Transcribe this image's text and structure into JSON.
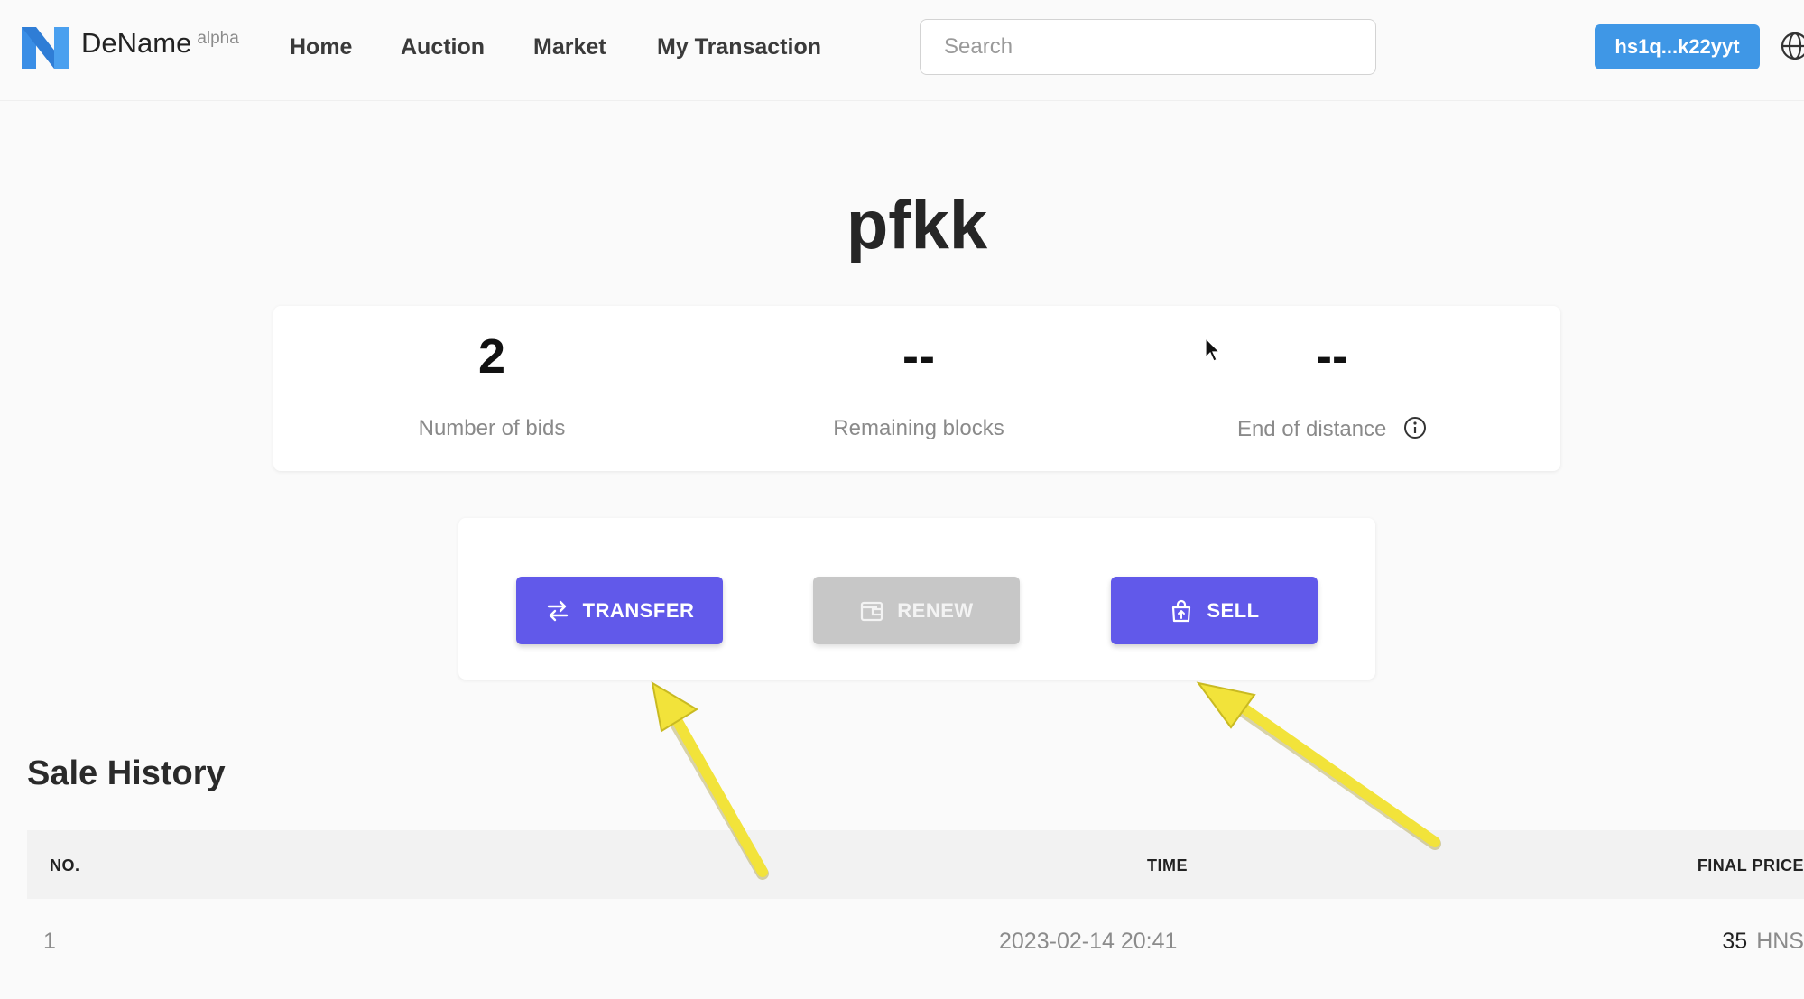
{
  "app": {
    "brand": "DeName",
    "brand_tag": "alpha",
    "accent_color": "#6159ea",
    "wallet_color": "#3f97e6",
    "logo_color": "#3a8ee6"
  },
  "nav": {
    "items": [
      {
        "label": "Home"
      },
      {
        "label": "Auction"
      },
      {
        "label": "Market"
      },
      {
        "label": "My Transaction"
      }
    ]
  },
  "search": {
    "placeholder": "Search",
    "value": ""
  },
  "wallet": {
    "address": "hs1q...k22yyt"
  },
  "domain": {
    "name": "pfkk"
  },
  "stats": [
    {
      "value": "2",
      "label": "Number of bids"
    },
    {
      "value": "--",
      "label": "Remaining blocks"
    },
    {
      "value": "--",
      "label": "End of distance",
      "icon": "info-icon"
    }
  ],
  "actions": [
    {
      "label": "TRANSFER",
      "icon": "transfer-icon",
      "enabled": true
    },
    {
      "label": "RENEW",
      "icon": "wallet-icon",
      "enabled": false
    },
    {
      "label": "SELL",
      "icon": "shopping-bag-icon",
      "enabled": true
    }
  ],
  "sale_history": {
    "title": "Sale History",
    "columns": [
      "NO.",
      "TIME",
      "FINAL PRICE"
    ],
    "rows": [
      {
        "no": "1",
        "time": "2023-02-14 20:41",
        "price": "35",
        "unit": "HNS"
      }
    ]
  },
  "annotations": {
    "arrow_color": "#f2e33a"
  }
}
